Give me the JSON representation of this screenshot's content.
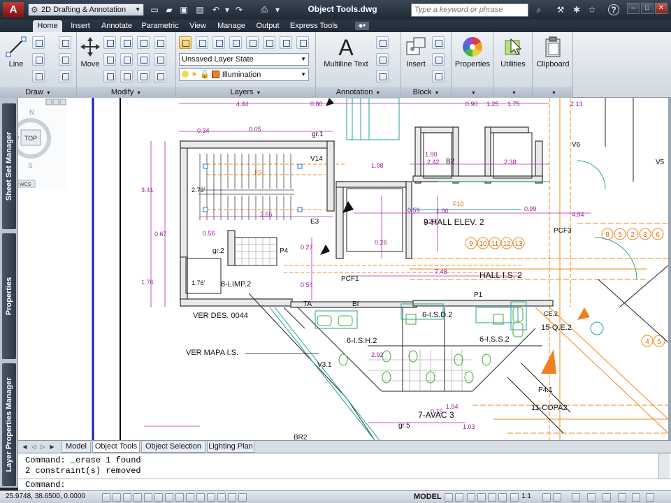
{
  "titlebar": {
    "logo": "A",
    "workspace": "2D Drafting & Annotation",
    "document_title": "Object Tools.dwg",
    "search_placeholder": "Type a keyword or phrase",
    "help": "?"
  },
  "ribbon_tabs": [
    "Home",
    "Insert",
    "Annotate",
    "Parametric",
    "View",
    "Manage",
    "Output",
    "Express Tools"
  ],
  "ribbon_active_tab": "Home",
  "panels": {
    "draw": {
      "title": "Draw",
      "line_label": "Line"
    },
    "modify": {
      "title": "Modify",
      "move_label": "Move"
    },
    "layers": {
      "title": "Layers",
      "layer_state": "Unsaved Layer State",
      "current_layer": "Illumination"
    },
    "annotation": {
      "title": "Annotation",
      "multiline_text_label": "Multiline Text"
    },
    "block": {
      "title": "Block",
      "insert_label": "Insert"
    },
    "properties": {
      "label": "Properties"
    },
    "utilities": {
      "label": "Utilities"
    },
    "clipboard": {
      "label": "Clipboard"
    }
  },
  "palettes": [
    "Sheet Set Manager",
    "Properties",
    "Layer Properties Manager"
  ],
  "viewcube": {
    "face": "TOP",
    "north": "N",
    "west": "W",
    "south": "S",
    "ucs": "WCS"
  },
  "drawing_labels": {
    "rooms": [
      "8-LIMP.2",
      "9-HALL ELEV. 2",
      "HALL I.S. 2",
      "6-I.S.D.2",
      "6-I.S.H.2",
      "6-I.S.S.2",
      "7-AVAC 3",
      "11-COPA2",
      "15-Q.E.2"
    ],
    "notes": [
      "VER DES. 0044",
      "VER MAPA I.S.",
      "BR2",
      "P4",
      "V3.1",
      "P4.1",
      "PCF1",
      "PCF3",
      "TA",
      "BI",
      "V14",
      "E3",
      "F5",
      "F10",
      "gr.1",
      "gr.2",
      "gr.5",
      "1.76'",
      "2.73'",
      "B2",
      "P1",
      "V6",
      "V5",
      "CE.2"
    ],
    "dims": [
      "4.44",
      "0.80",
      "0.90",
      "1.25",
      "1.75",
      "0.34",
      "0.05",
      "3.41",
      "0.67",
      "1.76",
      "1.90",
      "2.42",
      "2.38",
      "1.08",
      "0.59",
      "1.00",
      "0.99",
      "4.94",
      "2.20",
      "0.26",
      "7.48",
      "2.92",
      "0.15",
      "1.94",
      "1.03",
      "2.13",
      "0.27",
      "0.54",
      "0.56",
      "2.55"
    ],
    "bubbles_right": [
      "8",
      "5",
      "2",
      "3",
      "6"
    ],
    "bubbles_mid": [
      "9",
      "10",
      "11",
      "12",
      "13"
    ],
    "bubbles_far": [
      "4",
      "5"
    ]
  },
  "layout_tabs": [
    "Model",
    "Object Tools",
    "Object Selection",
    "Lighting Plan"
  ],
  "layout_active": "Object Tools",
  "command_history": [
    "Command: _erase 1 found",
    "2 constraint(s) removed"
  ],
  "command_prompt": "Command:",
  "status": {
    "coordinates": "25.9748, 38.6500, 0.0000",
    "mode": "MODEL",
    "scale": "1:1"
  }
}
